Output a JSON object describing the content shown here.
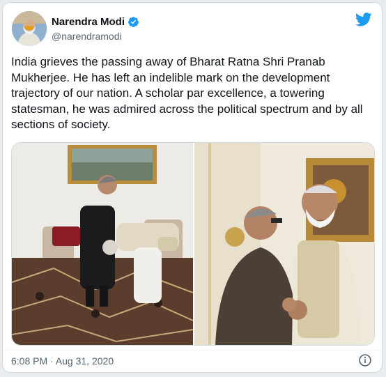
{
  "tweet": {
    "author": {
      "name": "Narendra Modi",
      "handle": "@narendramodi"
    },
    "text": "India grieves the passing away of Bharat Ratna Shri Pranab Mukherjee. He has left an indelible mark on the development trajectory of our nation. A scholar par excellence, a towering statesman, he was admired across the political spectrum and by all sections of society.",
    "timestamp": "6:08 PM · Aug 31, 2020"
  },
  "colors": {
    "twitter_blue": "#1d9bf0",
    "text": "#0f1419",
    "secondary_text": "#536471",
    "border": "#cfd9de"
  },
  "icons": {
    "brand": "twitter-bird-icon",
    "verified": "verified-badge-icon",
    "info": "info-icon"
  },
  "media": [
    {
      "description": "Photo 1"
    },
    {
      "description": "Photo 2"
    }
  ]
}
